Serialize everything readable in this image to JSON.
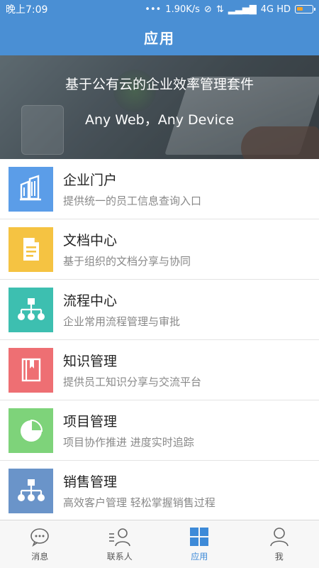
{
  "status": {
    "time": "晚上7:09",
    "speed": "1.90K/s",
    "network": "4G HD"
  },
  "header": {
    "title": "应用"
  },
  "banner": {
    "title": "基于公有云的企业效率管理套件",
    "subtitle": "Any Web，Any Device"
  },
  "apps": [
    {
      "name": "企业门户",
      "desc": "提供统一的员工信息查询入口",
      "icon": "building-icon",
      "color": "#5b9de8"
    },
    {
      "name": "文档中心",
      "desc": "基于组织的文档分享与协同",
      "icon": "document-icon",
      "color": "#f5c342"
    },
    {
      "name": "流程中心",
      "desc": "企业常用流程管理与审批",
      "icon": "flowchart-icon",
      "color": "#3dbfb0"
    },
    {
      "name": "知识管理",
      "desc": "提供员工知识分享与交流平台",
      "icon": "book-icon",
      "color": "#ee6f73"
    },
    {
      "name": "项目管理",
      "desc": "项目协作推进 进度实时追踪",
      "icon": "pie-chart-icon",
      "color": "#7ed37a"
    },
    {
      "name": "销售管理",
      "desc": "高效客户管理 轻松掌握销售过程",
      "icon": "org-chart-icon",
      "color": "#6a94c9"
    }
  ],
  "tabs": [
    {
      "label": "消息",
      "icon": "chat-bubble-icon",
      "active": false
    },
    {
      "label": "联系人",
      "icon": "contacts-icon",
      "active": false
    },
    {
      "label": "应用",
      "icon": "apps-grid-icon",
      "active": true
    },
    {
      "label": "我",
      "icon": "person-icon",
      "active": false
    }
  ]
}
